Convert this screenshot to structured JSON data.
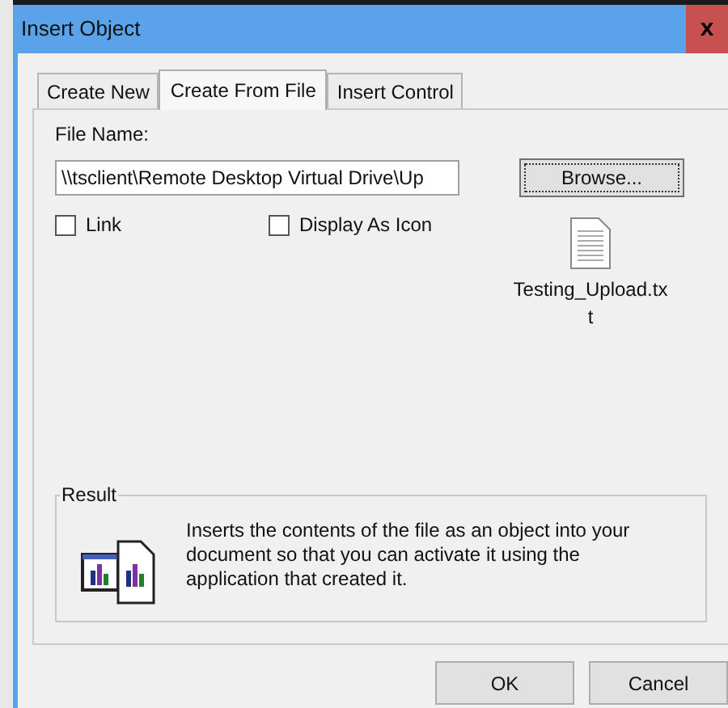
{
  "window": {
    "title": "Insert Object",
    "close": "x"
  },
  "tabs": [
    {
      "label": "Create New",
      "selected": false
    },
    {
      "label": "Create From File",
      "selected": true
    },
    {
      "label": "Insert Control",
      "selected": false
    }
  ],
  "file_name": {
    "label": "File Name:",
    "value": "\\\\tsclient\\Remote Desktop Virtual Drive\\Up"
  },
  "browse_button": "Browse...",
  "options": [
    {
      "label": "Link",
      "checked": false
    },
    {
      "label": "Display As Icon",
      "checked": false
    }
  ],
  "file_icon_caption": "Testing_Upload.txt",
  "result": {
    "title": "Result",
    "text": "Inserts the contents of the file as an object into your document so that you can activate it using the application that created it."
  },
  "buttons": [
    "OK",
    "Cancel"
  ]
}
